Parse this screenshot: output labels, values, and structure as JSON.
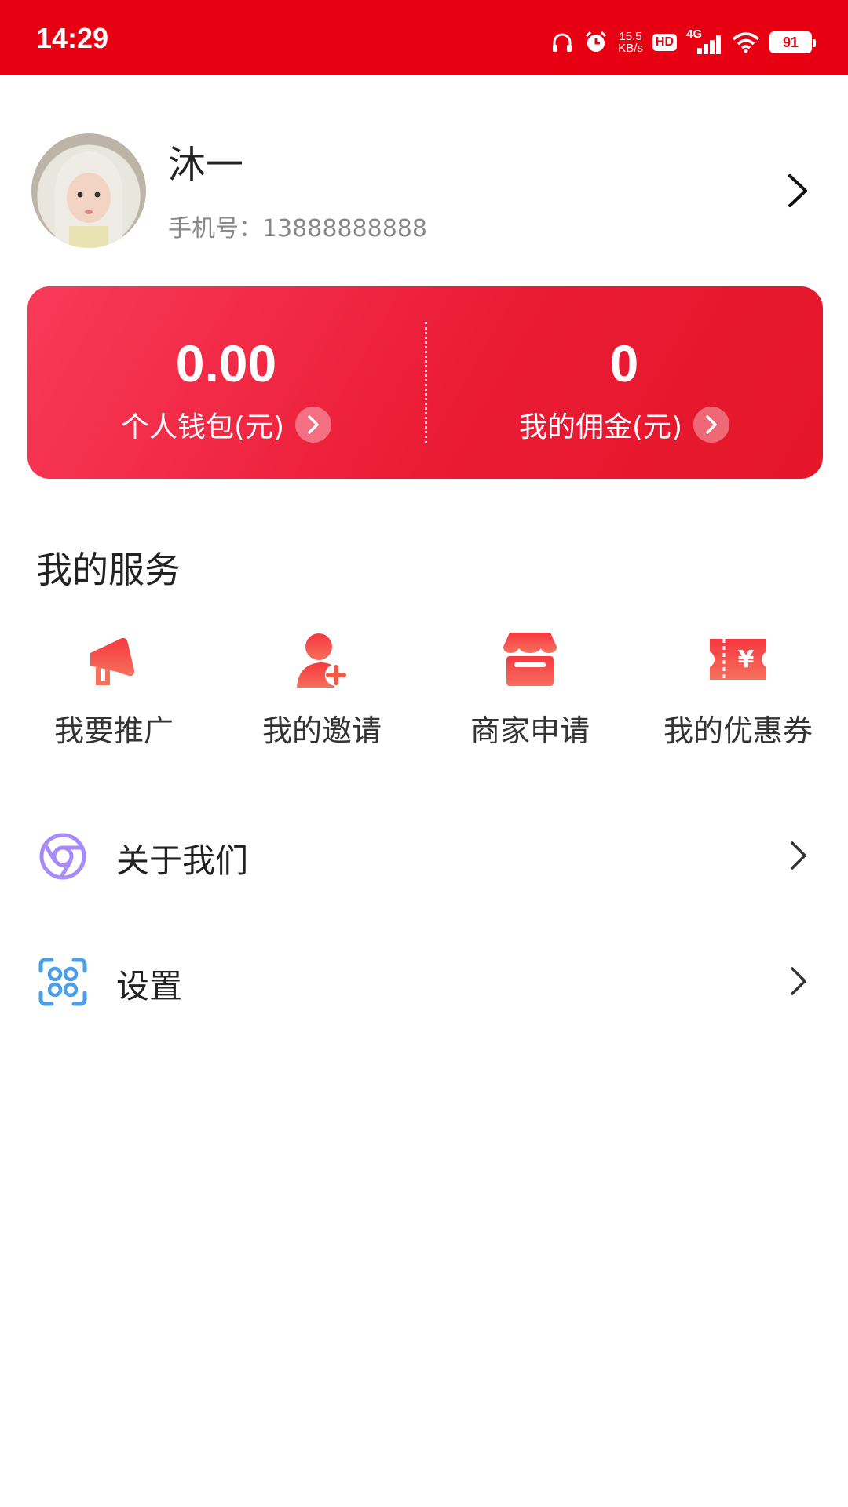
{
  "status_bar": {
    "time": "14:29",
    "net_speed_value": "15.5",
    "net_speed_unit": "KB/s",
    "hd_label": "HD",
    "network_type": "4G",
    "battery": "91",
    "background": "#e60012"
  },
  "profile": {
    "name": "沐一",
    "phone": "手机号：13888888888"
  },
  "wallet": {
    "left": {
      "amount": "0.00",
      "label": "个人钱包(元)"
    },
    "right": {
      "amount": "0",
      "label": "我的佣金(元)"
    },
    "gradient_colors": [
      "#f93a58",
      "#e41628"
    ]
  },
  "services": {
    "title": "我的服务",
    "items": [
      {
        "label": "我要推广",
        "icon": "megaphone-icon"
      },
      {
        "label": "我的邀请",
        "icon": "add-user-icon"
      },
      {
        "label": "商家申请",
        "icon": "store-icon"
      },
      {
        "label": "我的优惠券",
        "icon": "coupon-icon"
      }
    ],
    "icon_color": "#f2463a"
  },
  "menu": [
    {
      "label": "关于我们",
      "icon": "about-circle-icon",
      "color": "#a78bfa"
    },
    {
      "label": "设置",
      "icon": "settings-scan-icon",
      "color": "#4a9fe8"
    }
  ]
}
